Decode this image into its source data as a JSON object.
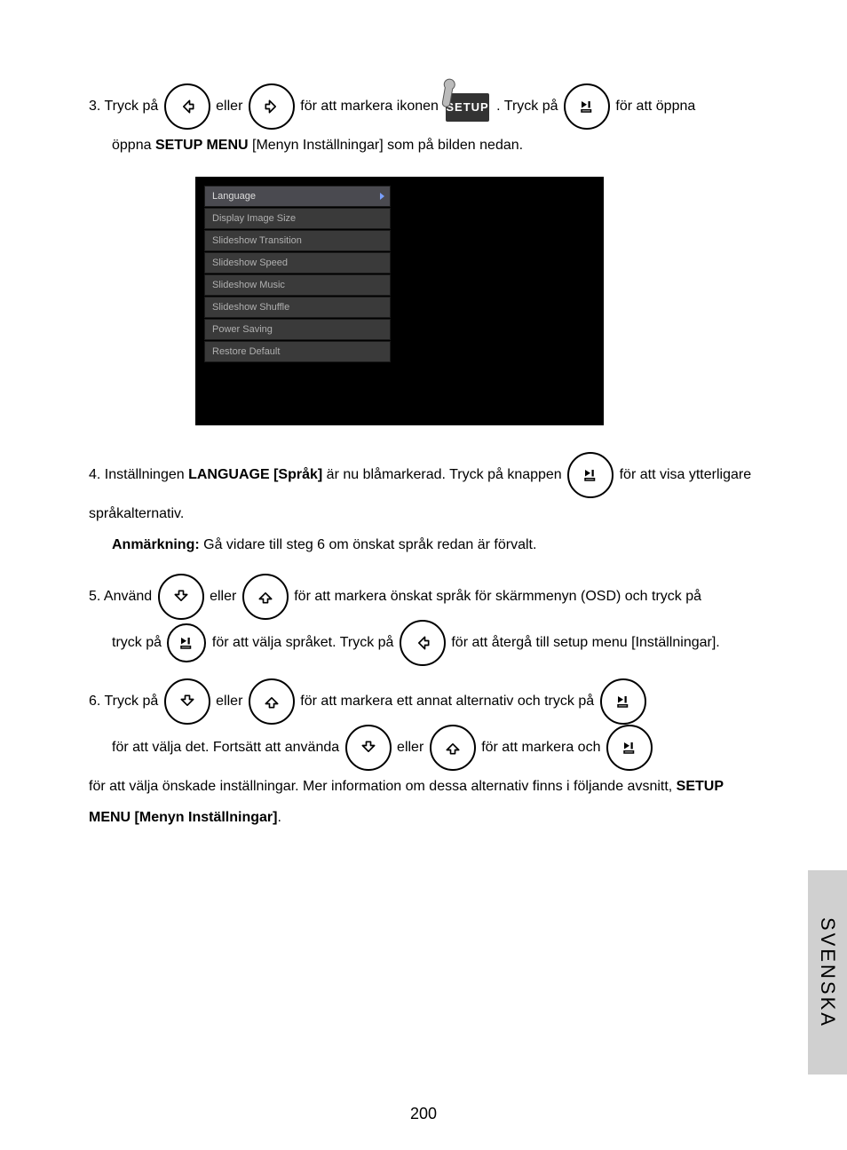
{
  "step3": {
    "num": "3.",
    "t1": "Tryck på ",
    "or": " eller ",
    "t2": " för att markera ikonen ",
    "setupLabel": "SETUP",
    "t3": " .  Tryck på ",
    "t4": " för att öppna ",
    "menu": "SETUP MENU",
    "t5": " [Menyn Inställningar] som på bilden nedan."
  },
  "menuItems": [
    "Language",
    "Display Image Size",
    "Slideshow Transition",
    "Slideshow Speed",
    "Slideshow Music",
    "Slideshow Shuffle",
    "Power Saving",
    "Restore Default"
  ],
  "step4": {
    "num": "4.",
    "t1": "Inställningen ",
    "lang": "LANGUAGE [Språk]",
    "t2": " är nu blåmarkerad. Tryck på knappen ",
    "t3": " för att visa ytterligare språkalternativ. ",
    "note": "Anmärkning:",
    "t4": " Gå vidare till steg 6 om önskat språk redan är förvalt."
  },
  "step5": {
    "num": "5.",
    "t1": "Använd ",
    "or": " eller ",
    "t2": " för att markera önskat språk för skärmmenyn (OSD) och tryck på ",
    "t3": " för att välja språket. Tryck på ",
    "t4": " för att återgå till setup menu [Inställningar]."
  },
  "step6": {
    "num": "6.",
    "t1": "Tryck på ",
    "or": " eller ",
    "t2": " för att markera ett annat alternativ och tryck på ",
    "t3": " för att välja det. Fortsätt att använda ",
    "t4": " för att markera och ",
    "t5": " för att välja önskade inställningar. Mer information om dessa alternativ finns i följande avsnitt, ",
    "menu": "SETUP MENU [Menyn Inställningar]",
    "dot": "."
  },
  "sideTab": "SVENSKA",
  "pageNum": "200"
}
